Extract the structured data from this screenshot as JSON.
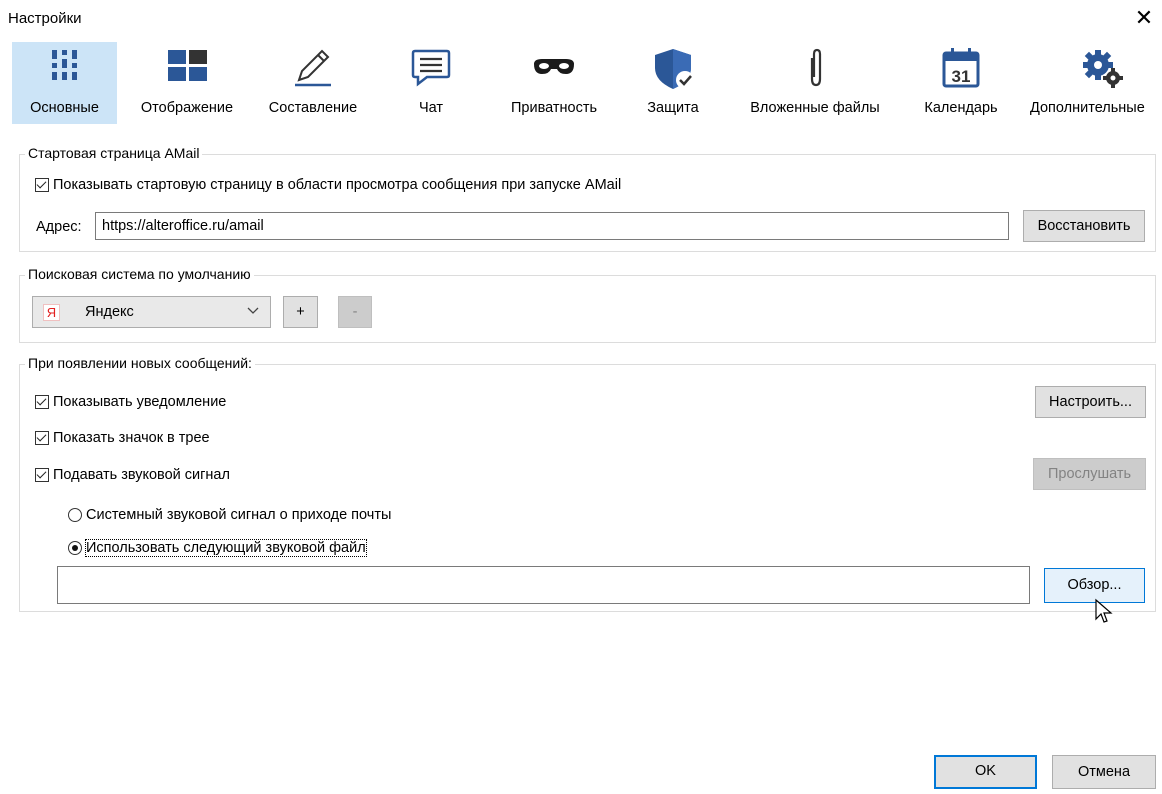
{
  "window": {
    "title": "Настройки",
    "close_icon": "close-icon"
  },
  "toolbar": {
    "items": [
      {
        "id": "general",
        "label": "Основные",
        "icon": "sliders-icon",
        "active": true
      },
      {
        "id": "display",
        "label": "Отображение",
        "icon": "layout-grid-icon"
      },
      {
        "id": "compose",
        "label": "Составление",
        "icon": "pencil-icon"
      },
      {
        "id": "chat",
        "label": "Чат",
        "icon": "chat-bubble-icon"
      },
      {
        "id": "privacy",
        "label": "Приватность",
        "icon": "mask-icon"
      },
      {
        "id": "security",
        "label": "Защита",
        "icon": "shield-check-icon"
      },
      {
        "id": "attachments",
        "label": "Вложенные файлы",
        "icon": "paperclip-icon"
      },
      {
        "id": "calendar",
        "label": "Календарь",
        "icon": "calendar-icon",
        "calendar_day": "31"
      },
      {
        "id": "advanced",
        "label": "Дополнительные",
        "icon": "gears-icon"
      }
    ]
  },
  "start_page": {
    "legend": "Стартовая страница AMail",
    "show_checkbox": {
      "label": "Показывать стартовую страницу в области просмотра сообщения при запуске AMail",
      "checked": true
    },
    "address_label": "Адрес:",
    "address_value": "https://alteroffice.ru/amail",
    "restore_button": "Восстановить"
  },
  "search": {
    "legend": "Поисковая система по умолчанию",
    "engine_badge": "Я",
    "engine": "Яндекс",
    "add_button": "+",
    "remove_button": "-"
  },
  "new_messages": {
    "legend": "При появлении новых сообщений:",
    "show_notification": {
      "label": "Показывать уведомление",
      "checked": true
    },
    "configure_button": "Настроить...",
    "tray_icon": {
      "label": "Показать значок в трее",
      "checked": true
    },
    "play_sound": {
      "label": "Подавать звуковой сигнал",
      "checked": true
    },
    "listen_button": "Прослушать",
    "system_sound_radio": {
      "label": "Системный звуковой сигнал о приходе почты",
      "selected": false
    },
    "custom_sound_radio": {
      "label": "Использовать следующий звуковой файл",
      "selected": true
    },
    "sound_file_value": "",
    "browse_button": "Обзор..."
  },
  "footer": {
    "ok_button": "OK",
    "cancel_button": "Отмена"
  },
  "colors": {
    "active_tab": "#cce4f7",
    "accent": "#0078d7",
    "brand_blue": "#2b5797"
  }
}
